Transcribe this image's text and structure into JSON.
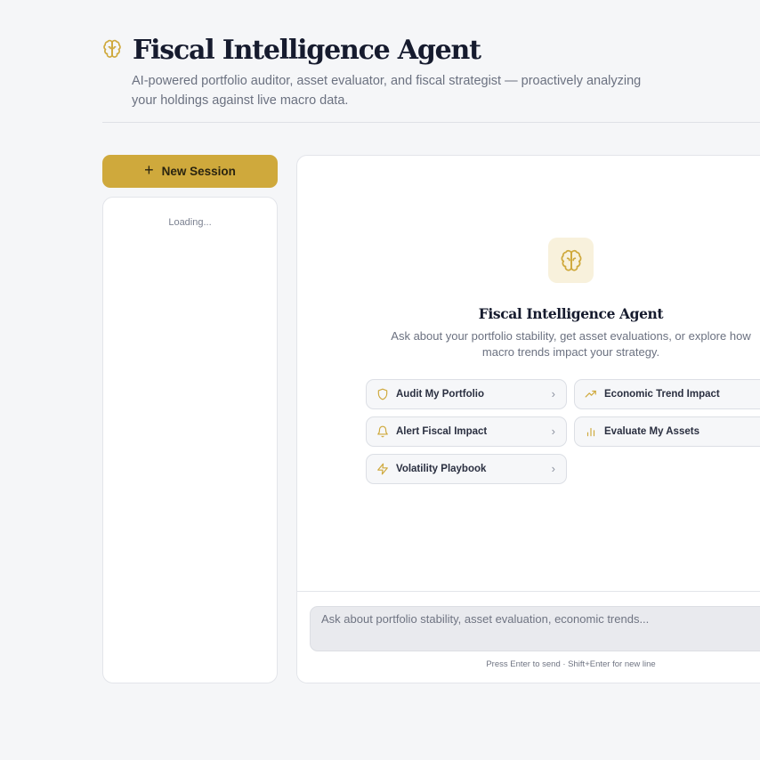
{
  "header": {
    "title": "Fiscal Intelligence Agent",
    "subtitle": "AI-powered portfolio auditor, asset evaluator, and fiscal strategist — proactively analyzing your holdings against live macro data.",
    "icon": "brain-icon"
  },
  "sidebar": {
    "new_session_label": "New Session",
    "loading_text": "Loading..."
  },
  "welcome": {
    "title": "Fiscal Intelligence Agent",
    "description": "Ask about your portfolio stability, get asset evaluations, or explore how macro trends impact your strategy."
  },
  "prompts": [
    {
      "label": "Audit My Portfolio",
      "icon": "shield-icon"
    },
    {
      "label": "Economic Trend Impact",
      "icon": "trending-up-icon"
    },
    {
      "label": "Alert Fiscal Impact",
      "icon": "bell-icon"
    },
    {
      "label": "Evaluate My Assets",
      "icon": "bar-chart-icon"
    },
    {
      "label": "Volatility Playbook",
      "icon": "lightning-icon"
    }
  ],
  "composer": {
    "placeholder": "Ask about portfolio stability, asset evaluation, economic trends...",
    "hint": "Press Enter to send · Shift+Enter for new line"
  },
  "colors": {
    "accent": "#cfa93c",
    "accent_soft": "#f8f1dc",
    "background": "#f5f6f8"
  }
}
